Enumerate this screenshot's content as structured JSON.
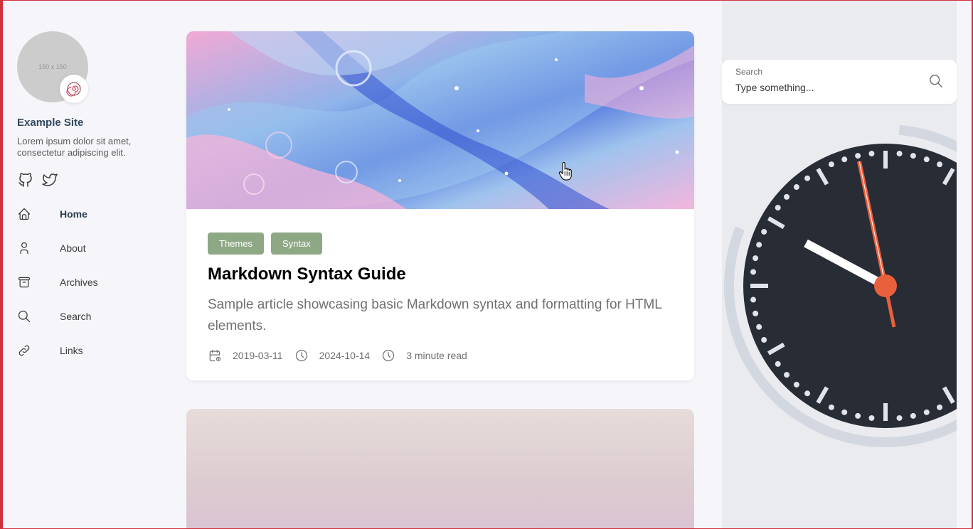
{
  "sidebar": {
    "avatar_placeholder": "150 x 150",
    "emoji": "🍥",
    "site_name": "Example Site",
    "site_description": "Lorem ipsum dolor sit amet, consectetur adipiscing elit.",
    "social": [
      {
        "icon": "github-icon"
      },
      {
        "icon": "twitter-icon"
      }
    ],
    "menu": [
      {
        "label": "Home",
        "icon": "home-icon",
        "active": true
      },
      {
        "label": "About",
        "icon": "user-icon",
        "active": false
      },
      {
        "label": "Archives",
        "icon": "archive-icon",
        "active": false
      },
      {
        "label": "Search",
        "icon": "search-icon",
        "active": false
      },
      {
        "label": "Links",
        "icon": "link-icon",
        "active": false
      }
    ]
  },
  "article": {
    "tags": [
      "Themes",
      "Syntax"
    ],
    "title": "Markdown Syntax Guide",
    "subtitle": "Sample article showcasing basic Markdown syntax and formatting for HTML elements.",
    "date_published": "2019-03-11",
    "date_updated": "2024-10-14",
    "reading_time": "3 minute read"
  },
  "search": {
    "label": "Search",
    "placeholder": "Type something..."
  },
  "colors": {
    "accent_tag": "#8ea885",
    "clock_face": "#272c35",
    "clock_second_hand": "#e8603c"
  }
}
